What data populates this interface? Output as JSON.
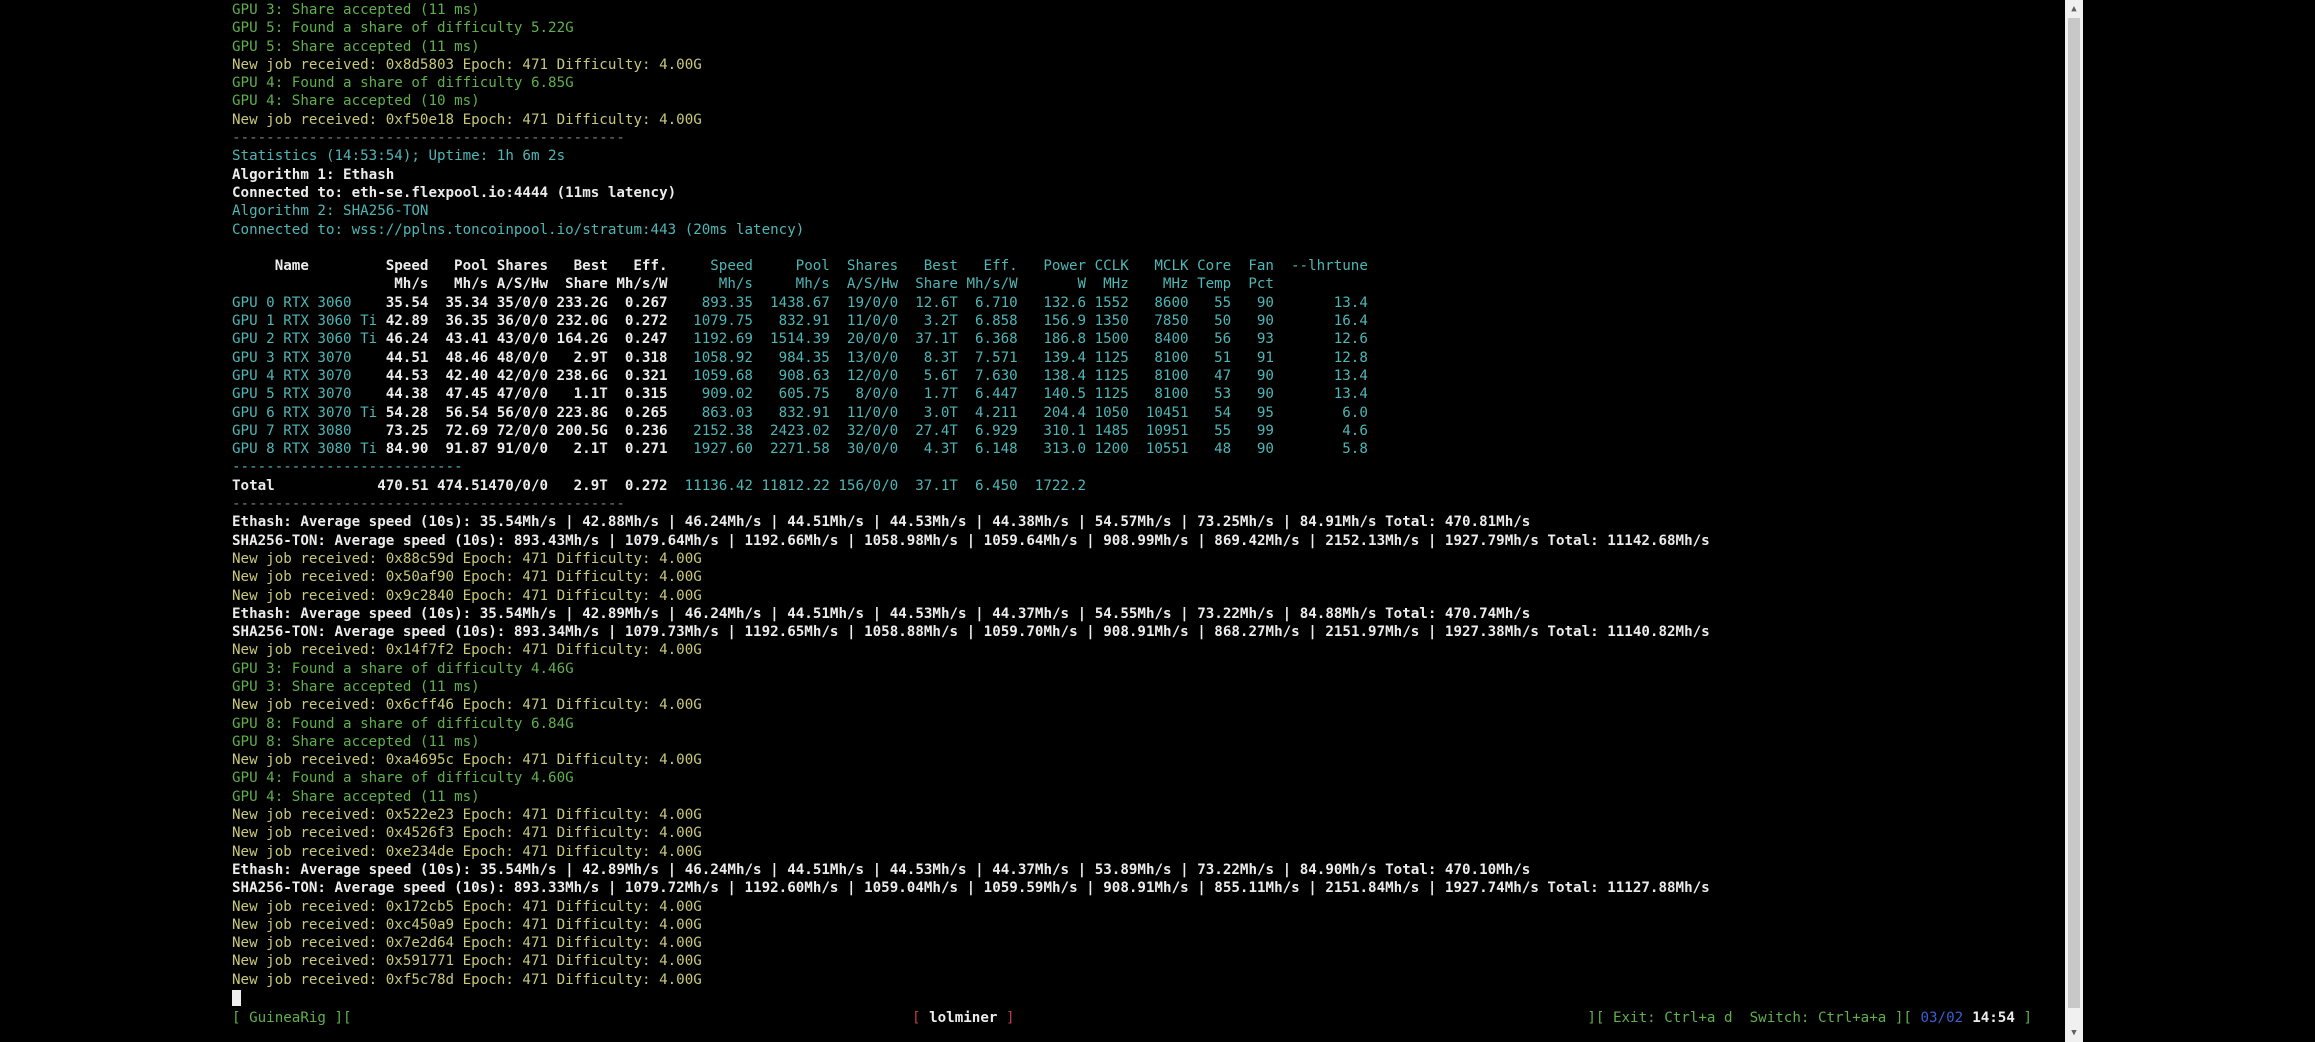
{
  "app": {
    "title": "lolminer"
  },
  "log_top": [
    {
      "text": "GPU 3: Share accepted (11 ms)",
      "color": "green"
    },
    {
      "text": "GPU 5: Found a share of difficulty 5.22G",
      "color": "green"
    },
    {
      "text": "GPU 5: Share accepted (11 ms)",
      "color": "green"
    },
    {
      "text": "New job received: 0x8d5803 Epoch: 471 Difficulty: 4.00G",
      "color": "yellow"
    },
    {
      "text": "GPU 4: Found a share of difficulty 6.85G",
      "color": "green"
    },
    {
      "text": "GPU 4: Share accepted (10 ms)",
      "color": "green"
    },
    {
      "text": "New job received: 0xf50e18 Epoch: 471 Difficulty: 4.00G",
      "color": "yellow"
    },
    {
      "text": "----------------------------------------------",
      "color": "gray"
    }
  ],
  "stats_header": [
    {
      "text": "Statistics (14:53:54); Uptime: 1h 6m 2s",
      "color": "cyan"
    },
    {
      "text": "Algorithm 1: Ethash",
      "color": "white"
    },
    {
      "text": "Connected to: eth-se.flexpool.io:4444 (11ms latency)",
      "color": "white"
    },
    {
      "text": "Algorithm 2: SHA256-TON",
      "color": "cyan"
    },
    {
      "text": "Connected to: wss://pplns.toncoinpool.io/stratum:443 (20ms latency)",
      "color": "cyan"
    }
  ],
  "table": {
    "header1": [
      "Name",
      "Speed",
      "Pool",
      "Shares",
      "Best",
      "Eff.",
      "Speed",
      "Pool",
      "Shares",
      "Best",
      "Eff.",
      "Power",
      "CCLK",
      "MCLK",
      "Core",
      "Fan",
      "--lhrtune"
    ],
    "header2": [
      "",
      "Mh/s",
      "Mh/s",
      "A/S/Hw",
      "Share",
      "Mh/s/W",
      "Mh/s",
      "Mh/s",
      "A/S/Hw",
      "Share",
      "Mh/s/W",
      "W",
      "MHz",
      "MHz",
      "Temp",
      "Pct",
      ""
    ],
    "rows": [
      [
        "GPU 0 RTX 3060",
        "35.54",
        "35.34",
        "35/0/0",
        "233.2G",
        "0.267",
        "893.35",
        "1438.67",
        "19/0/0",
        "12.6T",
        "6.710",
        "132.6",
        "1552",
        "8600",
        "55",
        "90",
        "13.4"
      ],
      [
        "GPU 1 RTX 3060 Ti",
        "42.89",
        "36.35",
        "36/0/0",
        "232.0G",
        "0.272",
        "1079.75",
        "832.91",
        "11/0/0",
        "3.2T",
        "6.858",
        "156.9",
        "1350",
        "7850",
        "50",
        "90",
        "16.4"
      ],
      [
        "GPU 2 RTX 3060 Ti",
        "46.24",
        "43.41",
        "43/0/0",
        "164.2G",
        "0.247",
        "1192.69",
        "1514.39",
        "20/0/0",
        "37.1T",
        "6.368",
        "186.8",
        "1500",
        "8400",
        "56",
        "93",
        "12.6"
      ],
      [
        "GPU 3 RTX 3070",
        "44.51",
        "48.46",
        "48/0/0",
        "2.9T",
        "0.318",
        "1058.92",
        "984.35",
        "13/0/0",
        "8.3T",
        "7.571",
        "139.4",
        "1125",
        "8100",
        "51",
        "91",
        "12.8"
      ],
      [
        "GPU 4 RTX 3070",
        "44.53",
        "42.40",
        "42/0/0",
        "238.6G",
        "0.321",
        "1059.68",
        "908.63",
        "12/0/0",
        "5.6T",
        "7.630",
        "138.4",
        "1125",
        "8100",
        "47",
        "90",
        "13.4"
      ],
      [
        "GPU 5 RTX 3070",
        "44.38",
        "47.45",
        "47/0/0",
        "1.1T",
        "0.315",
        "909.02",
        "605.75",
        "8/0/0",
        "1.7T",
        "6.447",
        "140.5",
        "1125",
        "8100",
        "53",
        "90",
        "13.4"
      ],
      [
        "GPU 6 RTX 3070 Ti",
        "54.28",
        "56.54",
        "56/0/0",
        "223.8G",
        "0.265",
        "863.03",
        "832.91",
        "11/0/0",
        "3.0T",
        "4.211",
        "204.4",
        "1050",
        "10451",
        "54",
        "95",
        "6.0"
      ],
      [
        "GPU 7 RTX 3080",
        "73.25",
        "72.69",
        "72/0/0",
        "200.5G",
        "0.236",
        "2152.38",
        "2423.02",
        "32/0/0",
        "27.4T",
        "6.929",
        "310.1",
        "1485",
        "10951",
        "55",
        "99",
        "4.6"
      ],
      [
        "GPU 8 RTX 3080 Ti",
        "84.90",
        "91.87",
        "91/0/0",
        "2.1T",
        "0.271",
        "1927.60",
        "2271.58",
        "30/0/0",
        "4.3T",
        "6.148",
        "313.0",
        "1200",
        "10551",
        "48",
        "90",
        "5.8"
      ]
    ],
    "separator": "---------------------------",
    "total": [
      "Total",
      "470.51",
      "474.51",
      "470/0/0",
      "2.9T",
      "0.272",
      "11136.42",
      "11812.22",
      "156/0/0",
      "37.1T",
      "6.450",
      "1722.2",
      "",
      "",
      "",
      "",
      ""
    ]
  },
  "log_bottom": [
    {
      "text": "----------------------------------------------",
      "color": "gray"
    },
    {
      "text": "Ethash: Average speed (10s): 35.54Mh/s | 42.88Mh/s | 46.24Mh/s | 44.51Mh/s | 44.53Mh/s | 44.38Mh/s | 54.57Mh/s | 73.25Mh/s | 84.91Mh/s Total: 470.81Mh/s",
      "color": "white"
    },
    {
      "text": "SHA256-TON: Average speed (10s): 893.43Mh/s | 1079.64Mh/s | 1192.66Mh/s | 1058.98Mh/s | 1059.64Mh/s | 908.99Mh/s | 869.42Mh/s | 2152.13Mh/s | 1927.79Mh/s Total: 11142.68Mh/s",
      "color": "white"
    },
    {
      "text": "New job received: 0x88c59d Epoch: 471 Difficulty: 4.00G",
      "color": "yellow"
    },
    {
      "text": "New job received: 0x50af90 Epoch: 471 Difficulty: 4.00G",
      "color": "yellow"
    },
    {
      "text": "New job received: 0x9c2840 Epoch: 471 Difficulty: 4.00G",
      "color": "yellow"
    },
    {
      "text": "Ethash: Average speed (10s): 35.54Mh/s | 42.89Mh/s | 46.24Mh/s | 44.51Mh/s | 44.53Mh/s | 44.37Mh/s | 54.55Mh/s | 73.22Mh/s | 84.88Mh/s Total: 470.74Mh/s",
      "color": "white"
    },
    {
      "text": "SHA256-TON: Average speed (10s): 893.34Mh/s | 1079.73Mh/s | 1192.65Mh/s | 1058.88Mh/s | 1059.70Mh/s | 908.91Mh/s | 868.27Mh/s | 2151.97Mh/s | 1927.38Mh/s Total: 11140.82Mh/s",
      "color": "white"
    },
    {
      "text": "New job received: 0x14f7f2 Epoch: 471 Difficulty: 4.00G",
      "color": "yellow"
    },
    {
      "text": "GPU 3: Found a share of difficulty 4.46G",
      "color": "green"
    },
    {
      "text": "GPU 3: Share accepted (11 ms)",
      "color": "green"
    },
    {
      "text": "New job received: 0x6cff46 Epoch: 471 Difficulty: 4.00G",
      "color": "yellow"
    },
    {
      "text": "GPU 8: Found a share of difficulty 6.84G",
      "color": "green"
    },
    {
      "text": "GPU 8: Share accepted (11 ms)",
      "color": "green"
    },
    {
      "text": "New job received: 0xa4695c Epoch: 471 Difficulty: 4.00G",
      "color": "yellow"
    },
    {
      "text": "GPU 4: Found a share of difficulty 4.60G",
      "color": "green"
    },
    {
      "text": "GPU 4: Share accepted (11 ms)",
      "color": "green"
    },
    {
      "text": "New job received: 0x522e23 Epoch: 471 Difficulty: 4.00G",
      "color": "yellow"
    },
    {
      "text": "New job received: 0x4526f3 Epoch: 471 Difficulty: 4.00G",
      "color": "yellow"
    },
    {
      "text": "New job received: 0xe234de Epoch: 471 Difficulty: 4.00G",
      "color": "yellow"
    },
    {
      "text": "Ethash: Average speed (10s): 35.54Mh/s | 42.89Mh/s | 46.24Mh/s | 44.51Mh/s | 44.53Mh/s | 44.37Mh/s | 53.89Mh/s | 73.22Mh/s | 84.90Mh/s Total: 470.10Mh/s",
      "color": "white"
    },
    {
      "text": "SHA256-TON: Average speed (10s): 893.33Mh/s | 1079.72Mh/s | 1192.60Mh/s | 1059.04Mh/s | 1059.59Mh/s | 908.91Mh/s | 855.11Mh/s | 2151.84Mh/s | 1927.74Mh/s Total: 11127.88Mh/s",
      "color": "white"
    },
    {
      "text": "New job received: 0x172cb5 Epoch: 471 Difficulty: 4.00G",
      "color": "yellow"
    },
    {
      "text": "New job received: 0xc450a9 Epoch: 471 Difficulty: 4.00G",
      "color": "yellow"
    },
    {
      "text": "New job received: 0x7e2d64 Epoch: 471 Difficulty: 4.00G",
      "color": "yellow"
    },
    {
      "text": "New job received: 0x591771 Epoch: 471 Difficulty: 4.00G",
      "color": "yellow"
    },
    {
      "text": "New job received: 0xf5c78d Epoch: 471 Difficulty: 4.00G",
      "color": "yellow"
    }
  ],
  "statusbar": {
    "left_open": "[ ",
    "host": "GuineaRig",
    "left_close": " ][",
    "mid_open": "[ ",
    "window_name": "lolminer",
    "mid_close": " ]",
    "right_text": "][ Exit: Ctrl+a d  Switch: Ctrl+a+a ][ ",
    "window_index": "03/02",
    "time": "14:54",
    "right_close": " ]"
  },
  "colors": {
    "green": "#5fb04d",
    "yellow": "#c8c87a",
    "white": "#ececec",
    "cyan": "#4fb6b6",
    "red": "#c04040",
    "blue": "#3b5fd0"
  }
}
